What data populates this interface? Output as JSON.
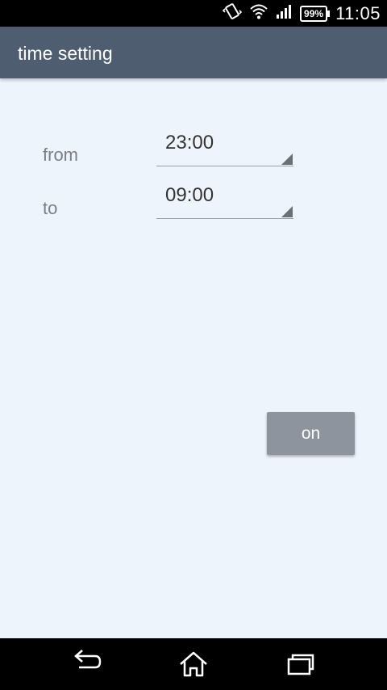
{
  "status_bar": {
    "battery": "99%",
    "time": "11:05",
    "icons": [
      "vibrate-icon",
      "wifi-icon",
      "signal-icon",
      "battery-icon"
    ]
  },
  "app_bar": {
    "title": "time setting"
  },
  "form": {
    "from_label": "from",
    "from_value": "23:00",
    "to_label": "to",
    "to_value": "09:00"
  },
  "actions": {
    "on_label": "on"
  },
  "nav_bar": {
    "icons": [
      "back-icon",
      "home-icon",
      "recent-apps-icon"
    ]
  },
  "colors": {
    "app_bar": "#4e5d6f",
    "background": "#eef4fc",
    "button": "#8d949e"
  }
}
